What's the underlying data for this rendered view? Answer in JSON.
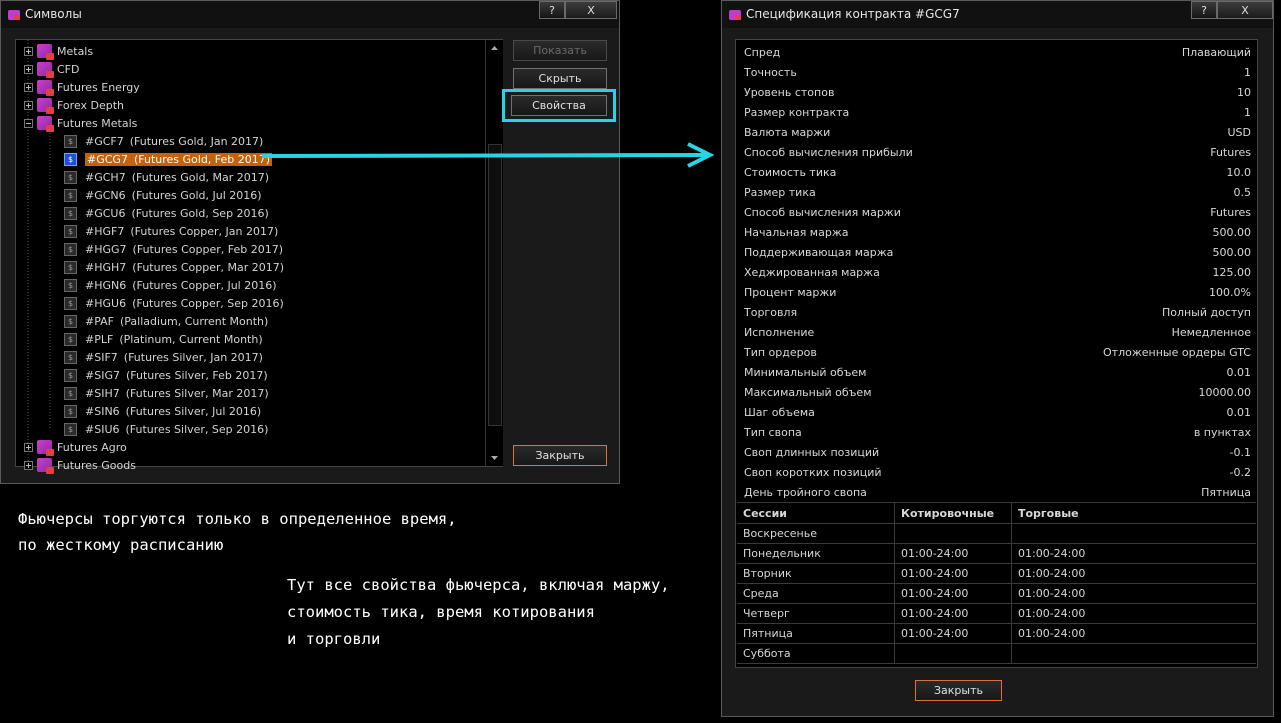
{
  "symbols_window": {
    "title": "Символы",
    "help_label": "?",
    "close_label": "X",
    "buttons": {
      "show": "Показать",
      "hide": "Скрыть",
      "properties": "Свойства",
      "close": "Закрыть"
    },
    "folders_top": [
      "Metals",
      "CFD",
      "Futures Energy",
      "Forex Depth",
      "Futures Metals"
    ],
    "symbols": [
      {
        "code": "#GCF7",
        "desc": "(Futures Gold, Jan 2017)"
      },
      {
        "code": "#GCG7",
        "desc": "(Futures Gold, Feb 2017)",
        "selected": true
      },
      {
        "code": "#GCH7",
        "desc": "(Futures Gold, Mar 2017)"
      },
      {
        "code": "#GCN6",
        "desc": "(Futures Gold, Jul 2016)"
      },
      {
        "code": "#GCU6",
        "desc": "(Futures Gold, Sep 2016)"
      },
      {
        "code": "#HGF7",
        "desc": "(Futures Copper, Jan 2017)"
      },
      {
        "code": "#HGG7",
        "desc": "(Futures Copper, Feb 2017)"
      },
      {
        "code": "#HGH7",
        "desc": "(Futures Copper, Mar 2017)"
      },
      {
        "code": "#HGN6",
        "desc": "(Futures Copper, Jul 2016)"
      },
      {
        "code": "#HGU6",
        "desc": "(Futures Copper, Sep 2016)"
      },
      {
        "code": "#PAF",
        "desc": "(Palladium, Current Month)"
      },
      {
        "code": "#PLF",
        "desc": "(Platinum, Current Month)"
      },
      {
        "code": "#SIF7",
        "desc": "(Futures Silver, Jan 2017)"
      },
      {
        "code": "#SIG7",
        "desc": "(Futures Silver, Feb 2017)"
      },
      {
        "code": "#SIH7",
        "desc": "(Futures Silver, Mar 2017)"
      },
      {
        "code": "#SIN6",
        "desc": "(Futures Silver, Jul 2016)"
      },
      {
        "code": "#SIU6",
        "desc": "(Futures Silver, Sep 2016)"
      }
    ],
    "folders_bottom": [
      "Futures Agro",
      "Futures Goods"
    ]
  },
  "spec_window": {
    "title": "Спецификация контракта #GCG7",
    "help_label": "?",
    "close_label": "X",
    "rows": [
      {
        "k": "Спред",
        "v": "Плавающий"
      },
      {
        "k": "Точность",
        "v": "1"
      },
      {
        "k": "Уровень стопов",
        "v": "10"
      },
      {
        "k": "Размер контракта",
        "v": "1"
      },
      {
        "k": "Валюта маржи",
        "v": "USD"
      },
      {
        "k": "Способ вычисления прибыли",
        "v": "Futures"
      },
      {
        "k": "Стоимость тика",
        "v": "10.0"
      },
      {
        "k": "Размер тика",
        "v": "0.5"
      },
      {
        "k": "Способ вычисления маржи",
        "v": "Futures"
      },
      {
        "k": "Начальная маржа",
        "v": "500.00"
      },
      {
        "k": "Поддерживающая маржа",
        "v": "500.00"
      },
      {
        "k": "Хеджированная маржа",
        "v": "125.00"
      },
      {
        "k": "Процент маржи",
        "v": "100.0%"
      },
      {
        "k": "Торговля",
        "v": "Полный доступ"
      },
      {
        "k": "Исполнение",
        "v": "Немедленное"
      },
      {
        "k": "Тип ордеров",
        "v": "Отложенные ордеры GTC"
      },
      {
        "k": "Минимальный объем",
        "v": "0.01"
      },
      {
        "k": "Максимальный объем",
        "v": "10000.00"
      },
      {
        "k": "Шаг объема",
        "v": "0.01"
      },
      {
        "k": "Тип свопа",
        "v": "в пунктах"
      },
      {
        "k": "Своп длинных позиций",
        "v": "-0.1"
      },
      {
        "k": "Своп коротких позиций",
        "v": "-0.2"
      },
      {
        "k": "День тройного свопа",
        "v": "Пятница"
      }
    ],
    "sessions_header": [
      "Сессии",
      "Котировочные",
      "Торговые"
    ],
    "sessions": [
      {
        "day": "Воскресенье",
        "quote": "",
        "trade": ""
      },
      {
        "day": "Понедельник",
        "quote": "01:00-24:00",
        "trade": "01:00-24:00"
      },
      {
        "day": "Вторник",
        "quote": "01:00-24:00",
        "trade": "01:00-24:00"
      },
      {
        "day": "Среда",
        "quote": "01:00-24:00",
        "trade": "01:00-24:00"
      },
      {
        "day": "Четверг",
        "quote": "01:00-24:00",
        "trade": "01:00-24:00"
      },
      {
        "day": "Пятница",
        "quote": "01:00-24:00",
        "trade": "01:00-24:00"
      },
      {
        "day": "Суббота",
        "quote": "",
        "trade": ""
      }
    ],
    "close_button": "Закрыть"
  },
  "annotations": {
    "left_line1": "Фьючерсы торгуются только в определенное время,",
    "left_line2": "по жесткому расписанию",
    "right_line1": "Тут все свойства фьючерса, включая маржу,",
    "right_line2": "стоимость тика, время котирования",
    "right_line3": "и торговли"
  },
  "colors": {
    "accent_cyan": "#29d3e6",
    "selection_orange": "#c8620a",
    "button_orange": "#e0703a"
  }
}
